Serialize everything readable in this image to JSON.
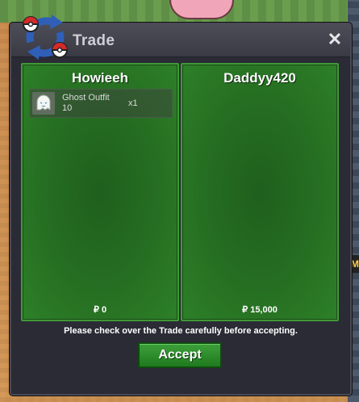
{
  "window": {
    "title": "Trade",
    "close_label": "✕",
    "icon": "trade-swap-icon"
  },
  "left_panel": {
    "player": "Howieeh",
    "items": [
      {
        "name": "Ghost Outfit 10",
        "qty": "x1",
        "icon": "ghost-outfit-icon"
      }
    ],
    "money": "₽ 0"
  },
  "right_panel": {
    "player": "Daddyy420",
    "items": [],
    "money": "₽ 15,000"
  },
  "notice": "Please check over the Trade carefully before accepting.",
  "accept_label": "Accept",
  "colors": {
    "panel_green": "#266f22",
    "window_bg": "#2b2b36",
    "accept_green": "#2e8c2c"
  }
}
